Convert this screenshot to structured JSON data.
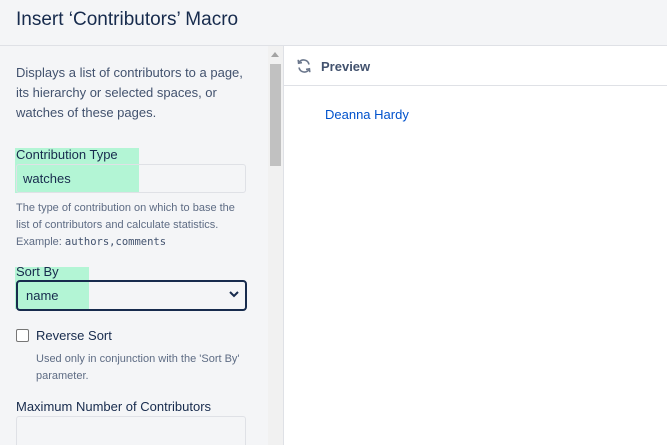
{
  "dialog": {
    "title": "Insert ‘Contributors’ Macro"
  },
  "form": {
    "description": "Displays a list of contributors to a page, its hierarchy or selected spaces, or watches of these pages.",
    "contribution_type": {
      "label": "Contribution Type",
      "value": "watches",
      "help_text": "The type of contribution on which to base the list of contributors and calculate statistics. Example: ",
      "help_example": "authors,comments"
    },
    "sort_by": {
      "label": "Sort By",
      "selected": "name"
    },
    "reverse_sort": {
      "label": "Reverse Sort",
      "checked": false,
      "help_text": "Used only in conjunction with the 'Sort By' parameter."
    },
    "max_contributors": {
      "label": "Maximum Number of Contributors",
      "value": ""
    }
  },
  "preview": {
    "title": "Preview",
    "contributors": [
      "Deanna Hardy"
    ]
  },
  "colors": {
    "highlight": "#b3f5d5",
    "link": "#0052cc",
    "panel_bg": "#f4f5f7"
  }
}
